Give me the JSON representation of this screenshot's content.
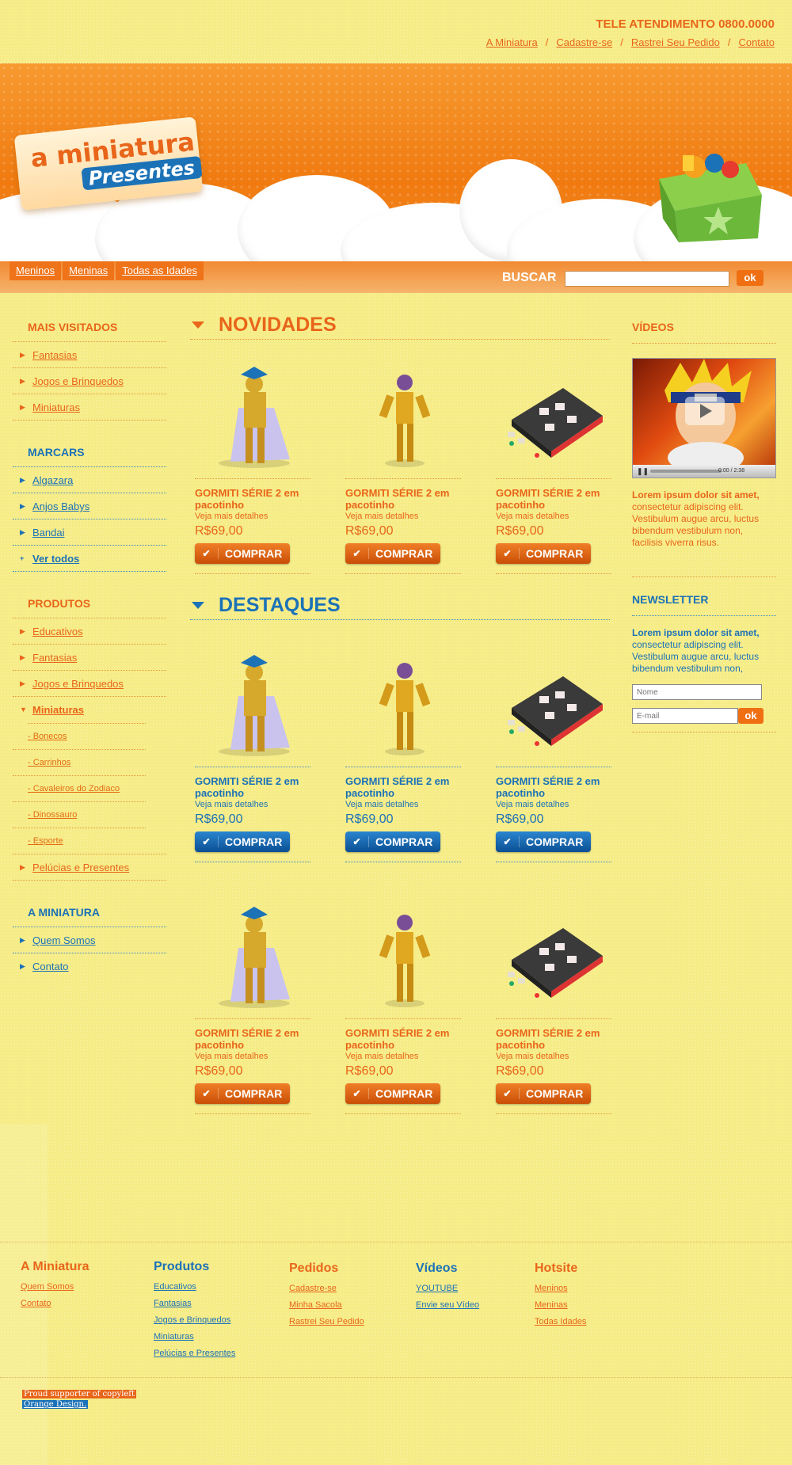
{
  "header": {
    "tele": "TELE ATENDIMENTO 0800.0000",
    "links": [
      "A Miniatura",
      "Cadastre-se",
      "Rastrei Seu Pedido",
      "Contato"
    ],
    "separator": "/"
  },
  "logo": {
    "line1": "a miniatura",
    "line2": "Presentes"
  },
  "nav": {
    "tabs": [
      "Meninos",
      "Meninas",
      "Todas as Idades"
    ],
    "search_label": "BUSCAR",
    "search_value": "",
    "search_button": "ok"
  },
  "sidebar": {
    "mais_visitados": {
      "title": "MAIS VISITADOS",
      "items": [
        "Fantasias",
        "Jogos e Brinquedos",
        "Miniaturas"
      ]
    },
    "marcars": {
      "title": "MARCARS",
      "items": [
        "Algazara",
        "Anjos Babys",
        "Bandai"
      ],
      "ver_todos": "Ver todos"
    },
    "produtos": {
      "title": "PRODUTOS",
      "items": [
        "Educativos",
        "Fantasias",
        "Jogos e Brinquedos"
      ],
      "active": "Miniaturas",
      "subitems": [
        "- Bonecos",
        "- Carrinhos",
        "- Cavaleiros do Zodiaco",
        "- Dinossauro",
        "- Esporte"
      ],
      "last": "Pelúcias e Presentes"
    },
    "a_miniatura": {
      "title": "A MINIATURA",
      "items": [
        "Quem Somos",
        "Contato"
      ]
    }
  },
  "novidades": {
    "title": "NOVIDADES",
    "products": [
      {
        "name": "GORMITI SÉRIE 2 em pacotinho",
        "details": "Veja mais detalhes",
        "price": "R$69,00",
        "button": "COMPRAR"
      },
      {
        "name": "GORMITI SÉRIE 2 em pacotinho",
        "details": "Veja mais detalhes",
        "price": "R$69,00",
        "button": "COMPRAR"
      },
      {
        "name": "GORMITI SÉRIE 2 em pacotinho",
        "details": "Veja mais detalhes",
        "price": "R$69,00",
        "button": "COMPRAR"
      }
    ]
  },
  "destaques": {
    "title": "DESTAQUES",
    "row1": [
      {
        "name": "GORMITI SÉRIE 2 em pacotinho",
        "details": "Veja mais detalhes",
        "price": "R$69,00",
        "button": "COMPRAR"
      },
      {
        "name": "GORMITI SÉRIE 2 em pacotinho",
        "details": "Veja mais detalhes",
        "price": "R$69,00",
        "button": "COMPRAR"
      },
      {
        "name": "GORMITI SÉRIE 2 em pacotinho",
        "details": "Veja mais detalhes",
        "price": "R$69,00",
        "button": "COMPRAR"
      }
    ],
    "row2": [
      {
        "name": "GORMITI SÉRIE 2 em pacotinho",
        "details": "Veja mais detalhes",
        "price": "R$69,00",
        "button": "COMPRAR"
      },
      {
        "name": "GORMITI SÉRIE 2 em pacotinho",
        "details": "Veja mais detalhes",
        "price": "R$69,00",
        "button": "COMPRAR"
      },
      {
        "name": "GORMITI SÉRIE 2 em pacotinho",
        "details": "Veja mais detalhes",
        "price": "R$69,00",
        "button": "COMPRAR"
      }
    ]
  },
  "right": {
    "videos_title": "VÍDEOS",
    "video_time": "0:00 / 2:38",
    "videos_text_bold": "Lorem ipsum dolor sit amet,",
    "videos_text": "consectetur adipiscing elit. Vestibulum augue arcu, luctus bibendum vestibulum non, facilisis viverra risus.",
    "newsletter_title": "NEWSLETTER",
    "newsletter_text_bold": "Lorem ipsum dolor sit amet,",
    "newsletter_text": "consectetur adipiscing elit. Vestibulum augue arcu, luctus bibendum vestibulum non,",
    "name_placeholder": "Nome",
    "email_placeholder": "E-mail",
    "ok": "ok"
  },
  "footer": {
    "cols": [
      {
        "title": "A Miniatura",
        "links": [
          "Quem Somos",
          "Contato"
        ]
      },
      {
        "title": "Produtos",
        "links": [
          "Educativos",
          "Fantasias",
          "Jogos e Brinquedos",
          "Miniaturas",
          "Pelúcias e Presentes"
        ]
      },
      {
        "title": "Pedidos",
        "links": [
          "Cadastre-se",
          "Minha Sacola",
          "Rastrei Seu Pedido"
        ]
      },
      {
        "title": "Vídeos",
        "links": [
          "YOUTUBE",
          "Envie seu Vídeo"
        ]
      },
      {
        "title": "Hotsite",
        "links": [
          "Meninos",
          "Meninas",
          "Todas Idades"
        ]
      }
    ],
    "credit1": "Proud supporter of copyleft",
    "credit2": "Orange Design."
  },
  "colors": {
    "orange": "#e8651a",
    "blue": "#1c72b7",
    "background": "#f6ec86"
  }
}
